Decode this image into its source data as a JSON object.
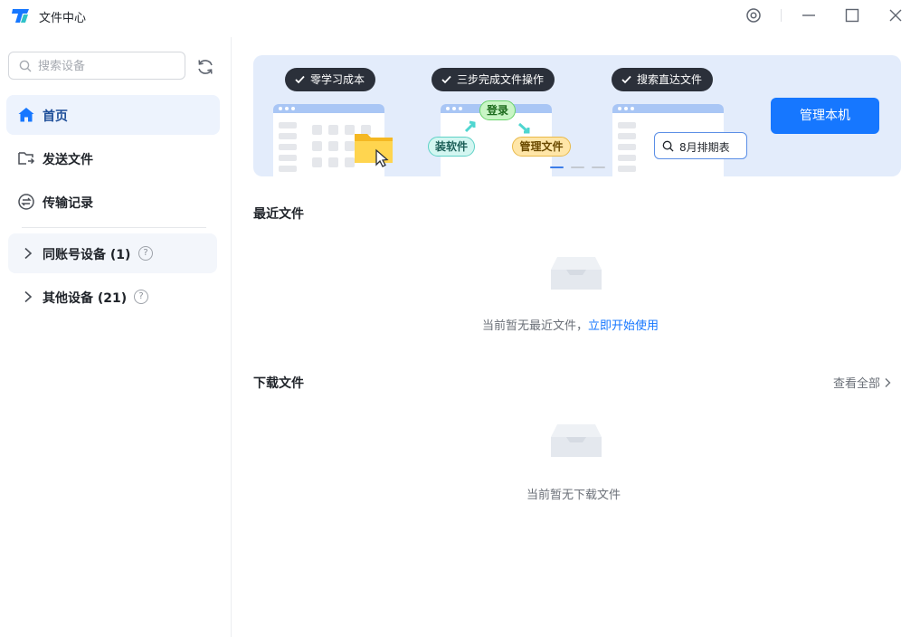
{
  "window": {
    "title": "文件中心"
  },
  "sidebar": {
    "search_placeholder": "搜索设备",
    "nav": [
      {
        "label": "首页",
        "icon": "home-icon",
        "active": true
      },
      {
        "label": "发送文件",
        "icon": "folder-send-icon"
      },
      {
        "label": "传输记录",
        "icon": "transfer-icon"
      }
    ],
    "groups": [
      {
        "label": "同账号设备 (1)",
        "icon": "chevron-right-icon"
      },
      {
        "label": "其他设备 (21)",
        "icon": "chevron-right-icon"
      }
    ],
    "help_glyph": "?"
  },
  "banner": {
    "pills": [
      "零学习成本",
      "三步完成文件操作",
      "搜索直达文件"
    ],
    "tags": {
      "login": "登录",
      "install": "装软件",
      "manage": "管理文件"
    },
    "search_text": "8月排期表",
    "manage_button": "管理本机",
    "slide_index": 1,
    "slide_count": 3
  },
  "recent": {
    "title": "最近文件",
    "empty_text": "当前暂无最近文件，",
    "action_link": "立即开始使用"
  },
  "downloads": {
    "title": "下载文件",
    "view_all": "查看全部",
    "empty_text": "当前暂无下载文件"
  },
  "colors": {
    "accent": "#1677ff",
    "active_nav_bg": "#edf3fd",
    "banner_bg": "#e3ecfb"
  }
}
